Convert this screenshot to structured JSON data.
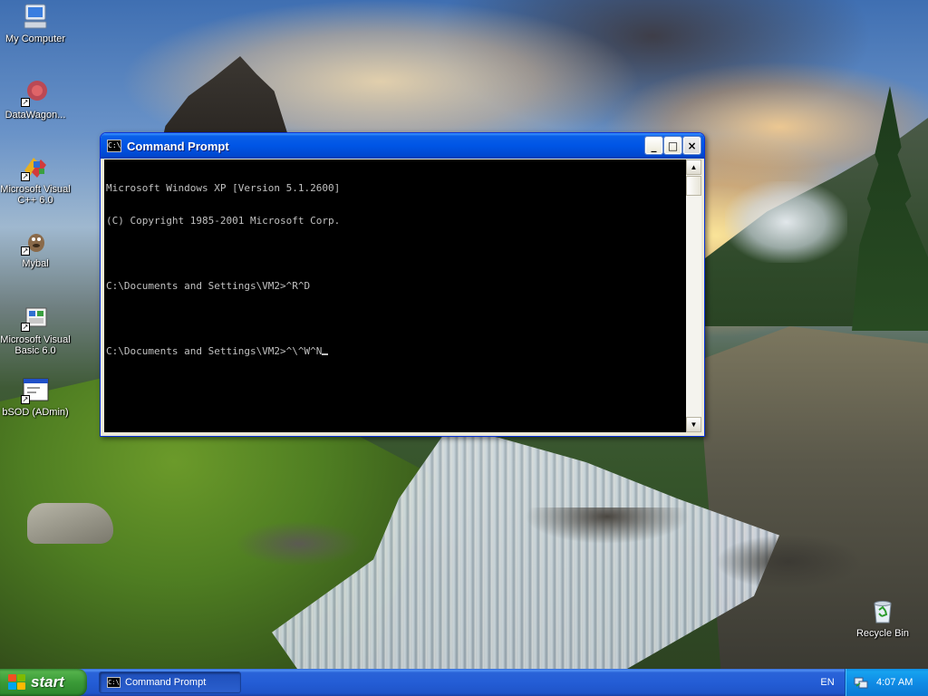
{
  "desktop": {
    "icons": [
      {
        "label": "My Computer",
        "icon": "my-computer-icon"
      },
      {
        "label": "DataWagon...",
        "icon": "datawagon-icon"
      },
      {
        "label": "Microsoft Visual C++ 6.0",
        "icon": "visual-cpp-icon"
      },
      {
        "label": "Mybal",
        "icon": "mybal-icon"
      },
      {
        "label": "Microsoft Visual Basic 6.0",
        "icon": "visual-basic-icon"
      },
      {
        "label": "bSOD (ADmin)",
        "icon": "bsod-shortcut-icon"
      },
      {
        "label": "Recycle Bin",
        "icon": "recycle-bin-icon"
      }
    ]
  },
  "window": {
    "title": "Command Prompt",
    "icon_text": "C:\\",
    "buttons": {
      "minimize": "_",
      "maximize": "□",
      "close": "×"
    },
    "console_lines": [
      "Microsoft Windows XP [Version 5.1.2600]",
      "(C) Copyright 1985-2001 Microsoft Corp.",
      "",
      "C:\\Documents and Settings\\VM2>^R^D",
      "",
      "C:\\Documents and Settings\\VM2>^\\^W^N"
    ]
  },
  "taskbar": {
    "start_label": "start",
    "tasks": [
      {
        "label": "Command Prompt",
        "icon_text": "C:\\"
      }
    ],
    "language": "EN",
    "clock": "4:07 AM"
  }
}
